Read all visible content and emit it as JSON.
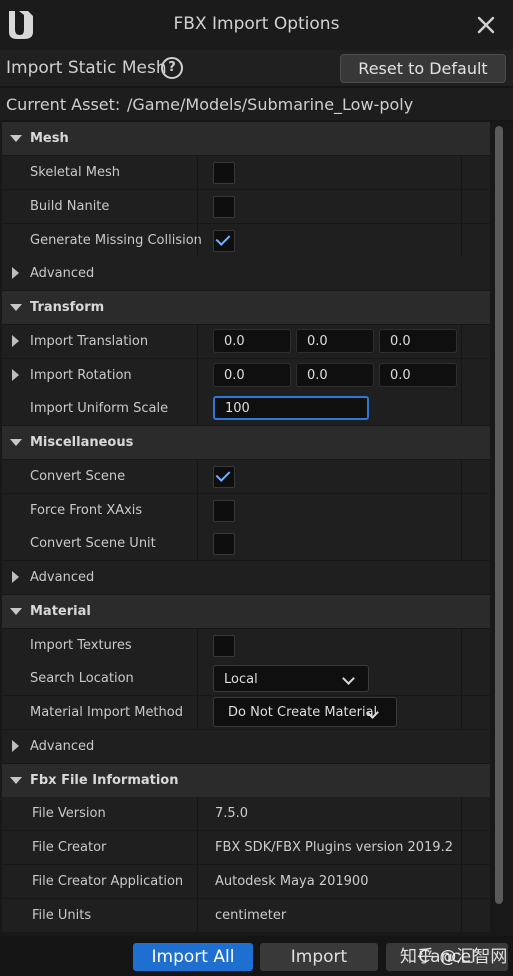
{
  "window": {
    "title": "FBX Import Options"
  },
  "header": {
    "import_type": "Import Static Mesh",
    "reset_label": "Reset to Default"
  },
  "asset": {
    "label": "Current Asset:",
    "path": "/Game/Models/Submarine_Low-poly"
  },
  "sections": {
    "mesh": {
      "title": "Mesh",
      "skeletal_mesh": {
        "label": "Skeletal Mesh",
        "checked": false
      },
      "build_nanite": {
        "label": "Build Nanite",
        "checked": false
      },
      "generate_missing_collision": {
        "label": "Generate Missing Collision",
        "checked": true
      },
      "advanced": "Advanced"
    },
    "transform": {
      "title": "Transform",
      "import_translation": {
        "label": "Import Translation",
        "x": "0.0",
        "y": "0.0",
        "z": "0.0"
      },
      "import_rotation": {
        "label": "Import Rotation",
        "x": "0.0",
        "y": "0.0",
        "z": "0.0"
      },
      "import_uniform_scale": {
        "label": "Import Uniform Scale",
        "value": "100"
      }
    },
    "miscellaneous": {
      "title": "Miscellaneous",
      "convert_scene": {
        "label": "Convert Scene",
        "checked": true
      },
      "force_front_xaxis": {
        "label": "Force Front XAxis",
        "checked": false
      },
      "convert_scene_unit": {
        "label": "Convert Scene Unit",
        "checked": false
      },
      "advanced": "Advanced"
    },
    "material": {
      "title": "Material",
      "import_textures": {
        "label": "Import Textures",
        "checked": false
      },
      "search_location": {
        "label": "Search Location",
        "value": "Local"
      },
      "material_import_method": {
        "label": "Material Import Method",
        "value": "Do Not Create Material"
      },
      "advanced": "Advanced"
    },
    "fbx_info": {
      "title": "Fbx File Information",
      "file_version": {
        "label": "File Version",
        "value": "7.5.0"
      },
      "file_creator": {
        "label": "File Creator",
        "value": "FBX SDK/FBX Plugins version 2019.2"
      },
      "file_creator_application": {
        "label": "File Creator Application",
        "value": "Autodesk Maya 201900"
      },
      "file_units": {
        "label": "File Units",
        "value": "centimeter"
      }
    }
  },
  "footer": {
    "import_all": "Import All",
    "import": "Import",
    "cancel": "Cancel"
  },
  "watermark": "知乎 @汇智网",
  "colors": {
    "accent": "#1e6fcf",
    "checkmark": "#6fb2ff",
    "panel": "#1f1f1f",
    "section": "#2b2b2b"
  }
}
